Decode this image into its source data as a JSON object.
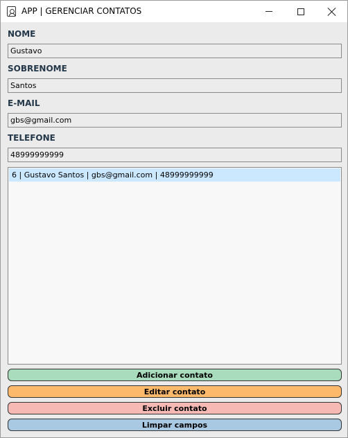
{
  "window": {
    "title": "APP | GERENCIAR CONTATOS",
    "icon": "contact-book-icon"
  },
  "form": {
    "nome": {
      "label": "NOME",
      "value": "Gustavo"
    },
    "sobrenome": {
      "label": "SOBRENOME",
      "value": "Santos"
    },
    "email": {
      "label": "E-MAIL",
      "value": "gbs@gmail.com"
    },
    "telefone": {
      "label": "TELEFONE",
      "value": "48999999999"
    }
  },
  "contacts": {
    "items": [
      {
        "text": "6 | Gustavo Santos | gbs@gmail.com | 48999999999",
        "selected": true
      }
    ]
  },
  "actions": {
    "add": {
      "label": "Adicionar contato",
      "color": "#a8dcbc"
    },
    "edit": {
      "label": "Editar contato",
      "color": "#fdb96b"
    },
    "delete": {
      "label": "Excluir contato",
      "color": "#f6b9b4"
    },
    "clear": {
      "label": "Limpar campos",
      "color": "#a9c8e2"
    }
  }
}
